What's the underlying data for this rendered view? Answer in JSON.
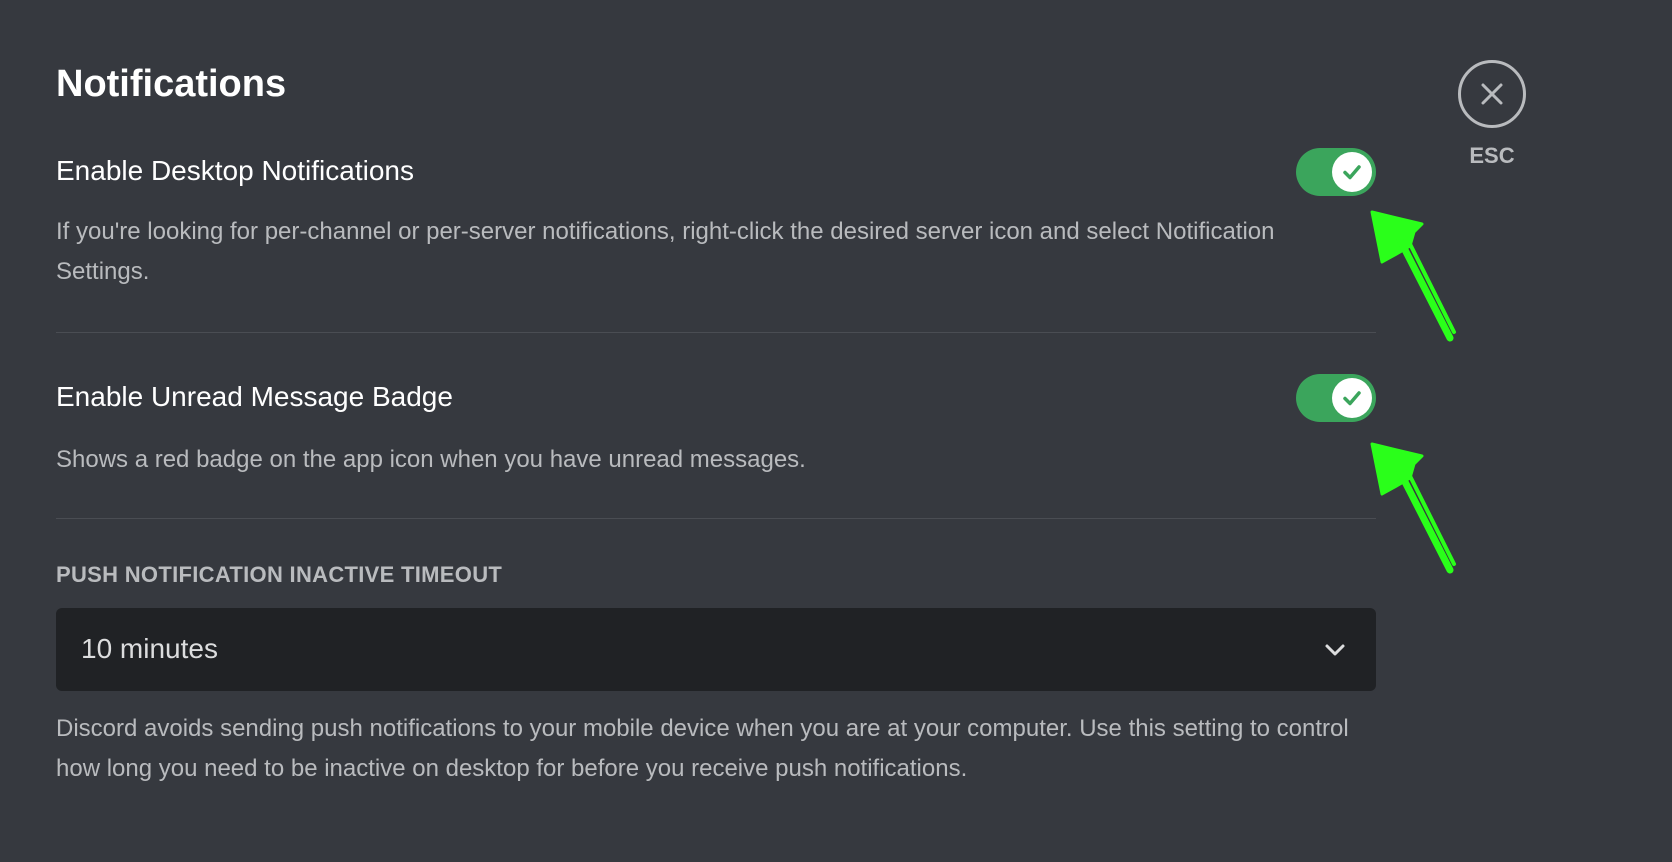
{
  "page": {
    "title": "Notifications"
  },
  "close": {
    "label": "ESC"
  },
  "settings": [
    {
      "title": "Enable Desktop Notifications",
      "description": "If you're looking for per-channel or per-server notifications, right-click the desired server icon and select Notification Settings.",
      "enabled": true
    },
    {
      "title": "Enable Unread Message Badge",
      "description": "Shows a red badge on the app icon when you have unread messages.",
      "enabled": true
    }
  ],
  "push_timeout": {
    "label": "PUSH NOTIFICATION INACTIVE TIMEOUT",
    "value": "10 minutes",
    "description": "Discord avoids sending push notifications to your mobile device when you are at your computer. Use this setting to control how long you need to be inactive on desktop for before you receive push notifications."
  },
  "icons": {
    "close": "close-icon",
    "check": "checkmark-icon",
    "chevron": "chevron-down-icon",
    "annotation": "hand-drawn-arrow"
  },
  "colors": {
    "background": "#36393f",
    "toggle_on": "#3ba55c",
    "select_bg": "#202225",
    "annotation": "#2aff1a"
  }
}
